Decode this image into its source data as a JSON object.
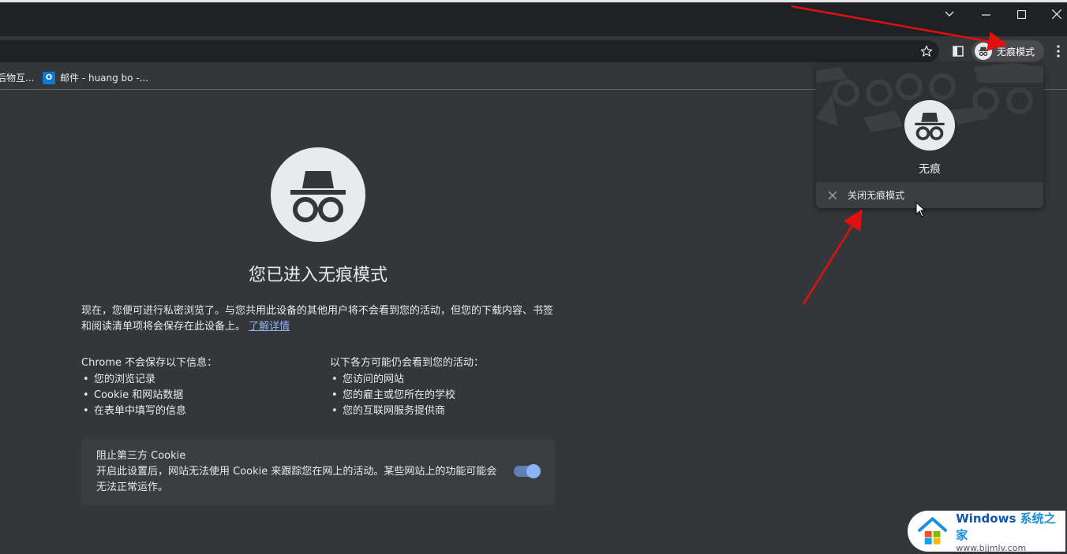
{
  "window": {
    "minimize_glyph": "—",
    "maximize_glyph": "☐",
    "close_glyph": "✕",
    "tabsearch_glyph": "⌄"
  },
  "toolbar": {
    "incognito_chip_label": "无痕模式"
  },
  "bookmarks": [
    {
      "label": "后物互..."
    },
    {
      "label": "邮件 - huang bo -...",
      "icon": "outlook-icon"
    }
  ],
  "ntp": {
    "title": "您已进入无痕模式",
    "intro": "现在，您便可进行私密浏览了。与您共用此设备的其他用户将不会看到您的活动，但您的下载内容、书签和阅读清单项将会保存在此设备上。",
    "learn_more": "了解详情",
    "not_saved_heading": "Chrome 不会保存以下信息：",
    "not_saved_items": [
      "您的浏览记录",
      "Cookie 和网站数据",
      "在表单中填写的信息"
    ],
    "visible_heading": "以下各方可能仍会看到您的活动：",
    "visible_items": [
      "您访问的网站",
      "您的雇主或您所在的学校",
      "您的互联网服务提供商"
    ],
    "cookie_card_title": "阻止第三方 Cookie",
    "cookie_card_desc": "开启此设置后，网站无法使用 Cookie 来跟踪您在网上的活动。某些网站上的功能可能会无法正常运作。",
    "cookie_toggle_on": true
  },
  "popup": {
    "profile_name": "无痕",
    "close_label": "关闭无痕模式"
  },
  "watermark": {
    "brand": "Windows",
    "brand_cn": "系统之家",
    "url": "www.bjjmlv.com"
  },
  "colors": {
    "accent": "#8ab4f8",
    "annotation_arrow": "#e01010"
  }
}
